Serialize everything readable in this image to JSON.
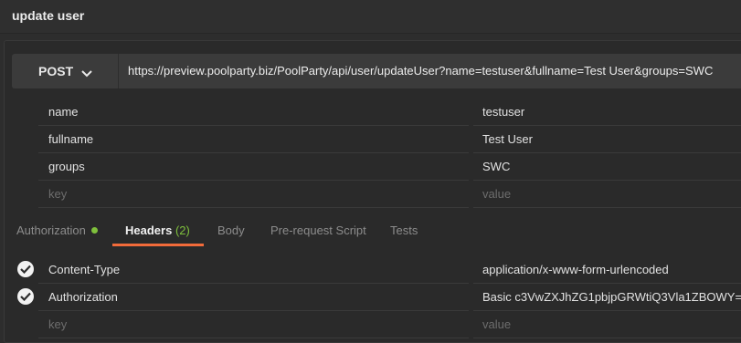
{
  "request": {
    "title": "update user"
  },
  "urlbar": {
    "method": "POST",
    "url": "https://preview.poolparty.biz/PoolParty/api/user/updateUser?name=testuser&fullname=Test User&groups=SWC"
  },
  "params": [
    {
      "key": "name",
      "value": "testuser"
    },
    {
      "key": "fullname",
      "value": "Test User"
    },
    {
      "key": "groups",
      "value": "SWC"
    }
  ],
  "params_placeholder": {
    "key": "key",
    "value": "value"
  },
  "tabs": {
    "authorization": "Authorization",
    "headers": "Headers",
    "headers_count": "(2)",
    "body": "Body",
    "prerequest": "Pre-request Script",
    "tests": "Tests"
  },
  "headers": [
    {
      "key": "Content-Type",
      "value": "application/x-www-form-urlencoded"
    },
    {
      "key": "Authorization",
      "value": "Basic c3VwZXJhZG1pbjpGRWtiQ3Vla1ZBOWY="
    }
  ],
  "headers_placeholder": {
    "key": "key",
    "value": "value"
  },
  "colors": {
    "accent": "#f26b3a",
    "status_dot": "#7fc03c"
  }
}
